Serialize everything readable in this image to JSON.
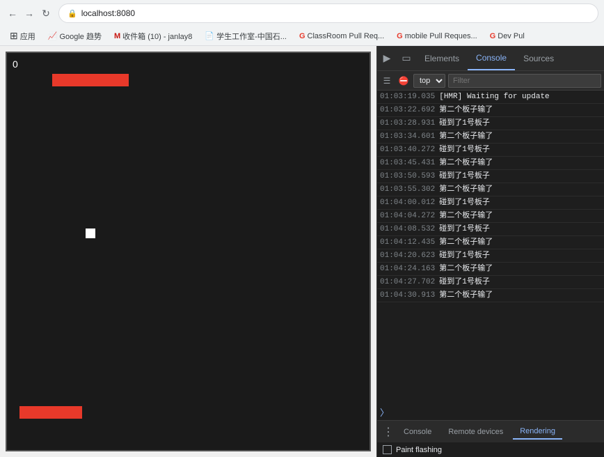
{
  "browser": {
    "url": "localhost:8080",
    "back_disabled": false,
    "forward_disabled": false
  },
  "bookmarks": [
    {
      "label": "应用",
      "icon": "⊞"
    },
    {
      "label": "Google 趋势",
      "icon": "📈"
    },
    {
      "label": "收件箱 (10) - janlay8",
      "icon": "M"
    },
    {
      "label": "学生工作室-中国石...",
      "icon": "📄"
    },
    {
      "label": "ClassRoom Pull Req...",
      "icon": "G"
    },
    {
      "label": "mobile Pull Reques...",
      "icon": "G"
    },
    {
      "label": "Dev Pul",
      "icon": "G"
    }
  ],
  "game": {
    "score": "0"
  },
  "devtools": {
    "tabs": [
      {
        "label": "Elements",
        "active": false
      },
      {
        "label": "Console",
        "active": true
      },
      {
        "label": "Sources",
        "active": false
      }
    ],
    "context": "top",
    "filter_placeholder": "Filter",
    "logs": [
      {
        "time": "01:03:19.035",
        "msg": "[HMR] Waiting for update"
      },
      {
        "time": "01:03:22.692",
        "msg": "第二个板子输了"
      },
      {
        "time": "01:03:28.931",
        "msg": "碰到了1号板子"
      },
      {
        "time": "01:03:34.601",
        "msg": "第二个板子输了"
      },
      {
        "time": "01:03:40.272",
        "msg": "碰到了1号板子"
      },
      {
        "time": "01:03:45.431",
        "msg": "第二个板子输了"
      },
      {
        "time": "01:03:50.593",
        "msg": "碰到了1号板子"
      },
      {
        "time": "01:03:55.302",
        "msg": "第二个板子输了"
      },
      {
        "time": "01:04:00.012",
        "msg": "碰到了1号板子"
      },
      {
        "time": "01:04:04.272",
        "msg": "第二个板子输了"
      },
      {
        "time": "01:04:08.532",
        "msg": "碰到了1号板子"
      },
      {
        "time": "01:04:12.435",
        "msg": "第二个板子输了"
      },
      {
        "time": "01:04:20.623",
        "msg": "碰到了1号板子"
      },
      {
        "time": "01:04:24.163",
        "msg": "第二个板子输了"
      },
      {
        "time": "01:04:27.702",
        "msg": "碰到了1号板子"
      },
      {
        "time": "01:04:30.913",
        "msg": "第二个板子输了"
      }
    ],
    "bottom_tabs": [
      {
        "label": "Console",
        "active": false
      },
      {
        "label": "Remote devices",
        "active": false
      },
      {
        "label": "Rendering",
        "active": true
      }
    ],
    "settings": {
      "paint_flashing_label": "Paint flashing"
    }
  }
}
